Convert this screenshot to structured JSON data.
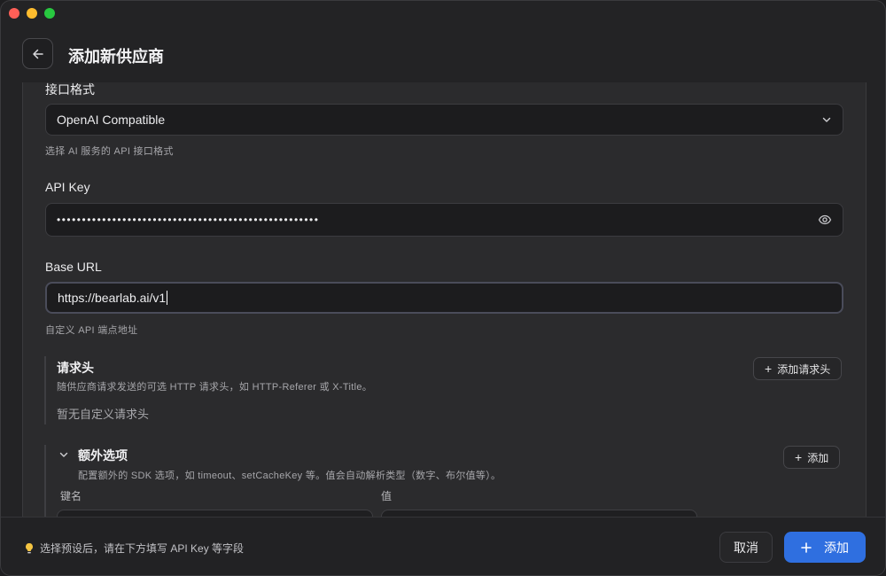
{
  "header": {
    "title": "添加新供应商"
  },
  "form": {
    "api_format": {
      "label": "接口格式",
      "value": "OpenAI Compatible",
      "hint": "选择 AI 服务的 API 接口格式"
    },
    "api_key": {
      "label": "API Key",
      "masked_value": "••••••••••••••••••••••••••••••••••••••••••••••••••••"
    },
    "base_url": {
      "label": "Base URL",
      "value": "https://bearlab.ai/v1",
      "hint": "自定义 API 端点地址"
    },
    "headers": {
      "title": "请求头",
      "description": "随供应商请求发送的可选 HTTP 请求头，如 HTTP-Referer 或 X-Title。",
      "empty": "暂无自定义请求头",
      "add_label": "添加请求头"
    },
    "extra": {
      "title": "额外选项",
      "description": "配置额外的 SDK 选项，如 timeout、setCacheKey 等。值会自动解析类型（数字、布尔值等）。",
      "add_label": "添加",
      "key_label": "键名",
      "value_label": "值"
    }
  },
  "footer": {
    "hint": "选择预设后，请在下方填写 API Key 等字段",
    "cancel_label": "取消",
    "submit_label": "添加"
  },
  "colors": {
    "accent": "#2f6fe0",
    "bulb": "#f5c542"
  }
}
